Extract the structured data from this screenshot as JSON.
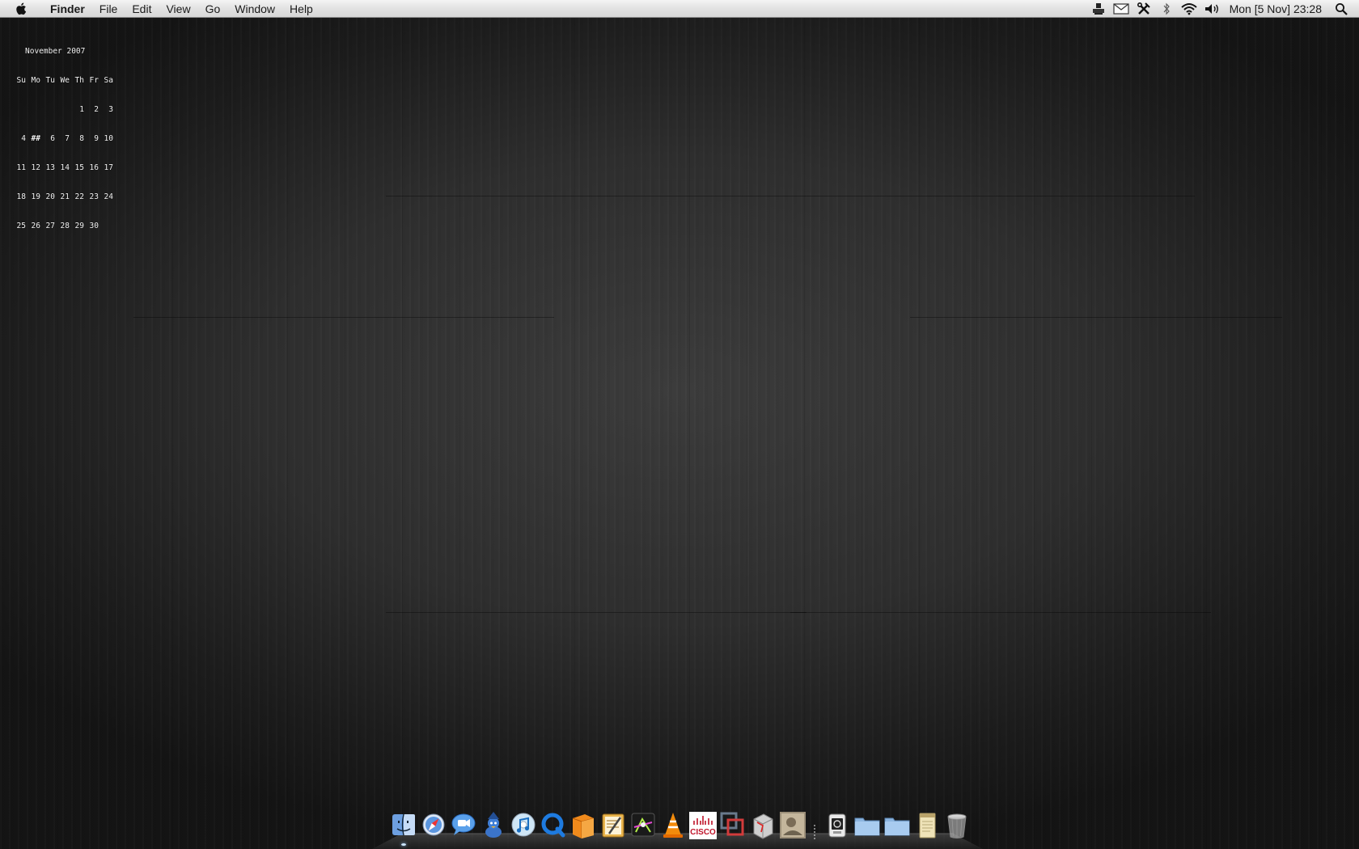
{
  "menubar": {
    "apple_icon": "apple-icon",
    "app_name": "Finder",
    "menus": [
      "File",
      "Edit",
      "View",
      "Go",
      "Window",
      "Help"
    ],
    "status_icons": [
      "script-icon",
      "mail-icon",
      "tools-icon",
      "bluetooth-icon",
      "wifi-icon",
      "volume-icon"
    ],
    "clock": "Mon [5 Nov] 23:28",
    "spotlight_icon": "spotlight-search-icon"
  },
  "calendar": {
    "title": "November 2007",
    "weekdays": [
      "Su",
      "Mo",
      "Tu",
      "We",
      "Th",
      "Fr",
      "Sa"
    ],
    "weeks": [
      [
        "",
        "",
        "",
        "",
        "1",
        "2",
        "3"
      ],
      [
        "4",
        "##",
        "6",
        "7",
        "8",
        "9",
        "10"
      ],
      [
        "11",
        "12",
        "13",
        "14",
        "15",
        "16",
        "17"
      ],
      [
        "18",
        "19",
        "20",
        "21",
        "22",
        "23",
        "24"
      ],
      [
        "25",
        "26",
        "27",
        "28",
        "29",
        "30",
        ""
      ]
    ]
  },
  "dock": {
    "apps": [
      {
        "name": "finder-icon",
        "running": true
      },
      {
        "name": "safari-icon",
        "running": false
      },
      {
        "name": "ichat-icon",
        "running": false
      },
      {
        "name": "adium-icon",
        "running": false
      },
      {
        "name": "itunes-icon",
        "running": false
      },
      {
        "name": "quicktime-icon",
        "running": false
      },
      {
        "name": "box-app-icon",
        "running": false
      },
      {
        "name": "textedit-icon",
        "running": false
      },
      {
        "name": "keynote-icon",
        "running": false
      },
      {
        "name": "vlc-icon",
        "running": false
      },
      {
        "name": "cisco-icon",
        "running": false
      },
      {
        "name": "vmware-icon",
        "running": false
      },
      {
        "name": "app-store-box-icon",
        "running": false
      },
      {
        "name": "photo-app-icon",
        "running": false
      }
    ],
    "cisco_text": "CISCO",
    "stacks": [
      {
        "name": "system-preferences-icon"
      },
      {
        "name": "documents-folder-icon"
      },
      {
        "name": "downloads-folder-icon"
      },
      {
        "name": "notepad-icon"
      },
      {
        "name": "trash-icon"
      }
    ]
  }
}
